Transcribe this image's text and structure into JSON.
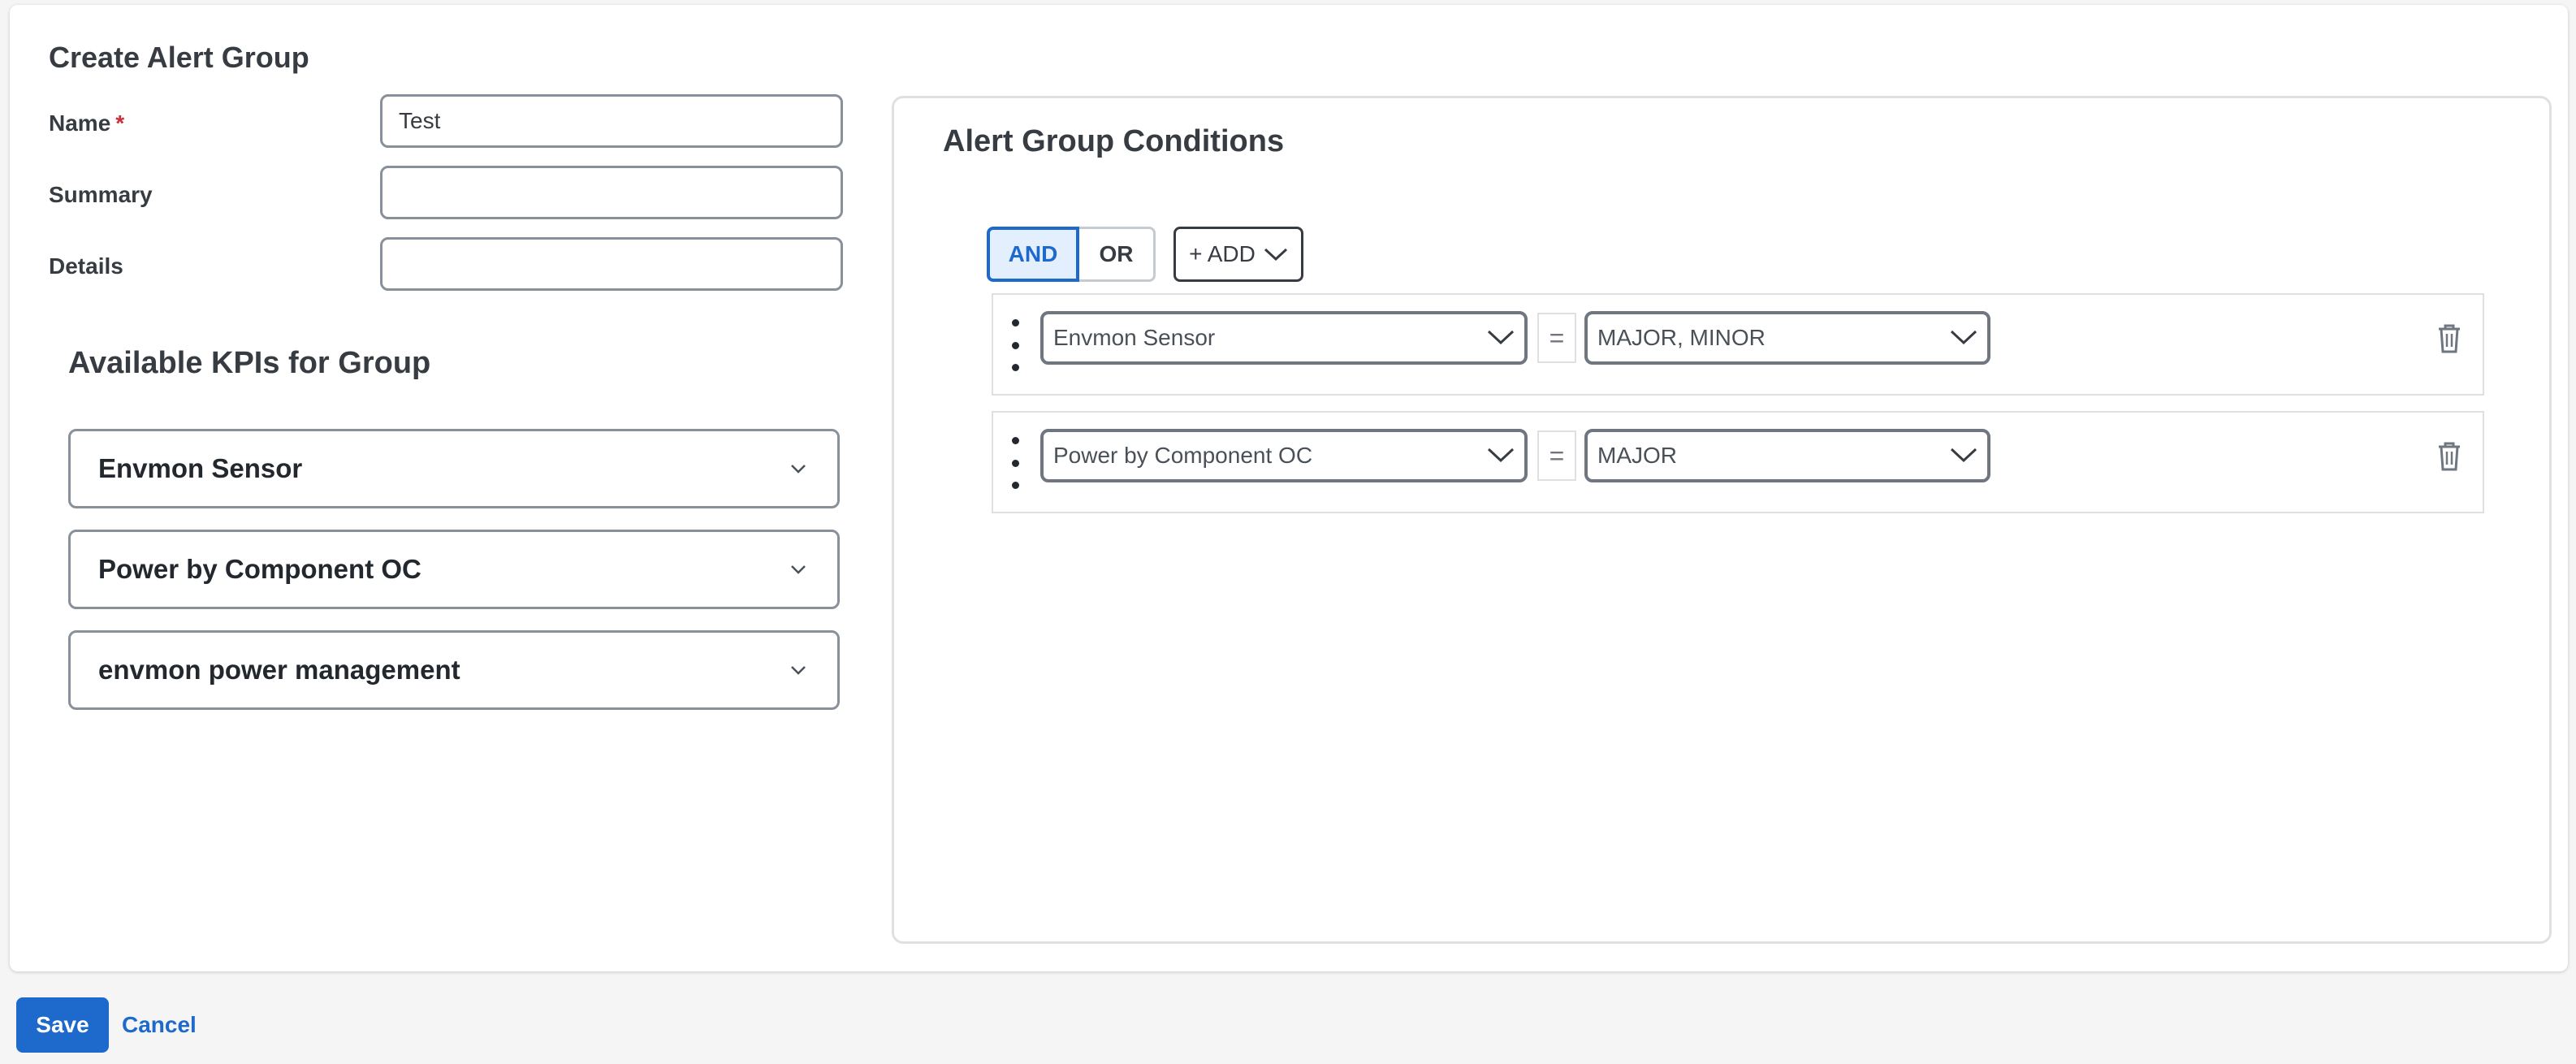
{
  "page": {
    "title": "Create Alert Group"
  },
  "form": {
    "name": {
      "label": "Name",
      "required_mark": "*",
      "value": "Test",
      "placeholder": ""
    },
    "summary": {
      "label": "Summary",
      "value": "",
      "placeholder": ""
    },
    "details": {
      "label": "Details",
      "value": "",
      "placeholder": ""
    }
  },
  "kpis": {
    "title": "Available KPIs for Group",
    "items": [
      {
        "label": "Envmon Sensor",
        "icon": "chevron-down-icon"
      },
      {
        "label": "Power by Component OC",
        "icon": "chevron-down-icon"
      },
      {
        "label": "envmon power management",
        "icon": "chevron-down-icon"
      }
    ]
  },
  "conditions": {
    "title": "Alert Group Conditions",
    "logic": {
      "and_label": "AND",
      "or_label": "OR",
      "selected": "AND"
    },
    "add_label": "+ ADD",
    "operator": "=",
    "rows": [
      {
        "kpi": "Envmon Sensor",
        "severity": "MAJOR, MINOR"
      },
      {
        "kpi": "Power by Component OC",
        "severity": "MAJOR"
      }
    ]
  },
  "footer": {
    "save_label": "Save",
    "cancel_label": "Cancel"
  },
  "colors": {
    "primary": "#1d69cc",
    "required": "#cc2d37",
    "text": "#373c42",
    "border": "#889099"
  }
}
